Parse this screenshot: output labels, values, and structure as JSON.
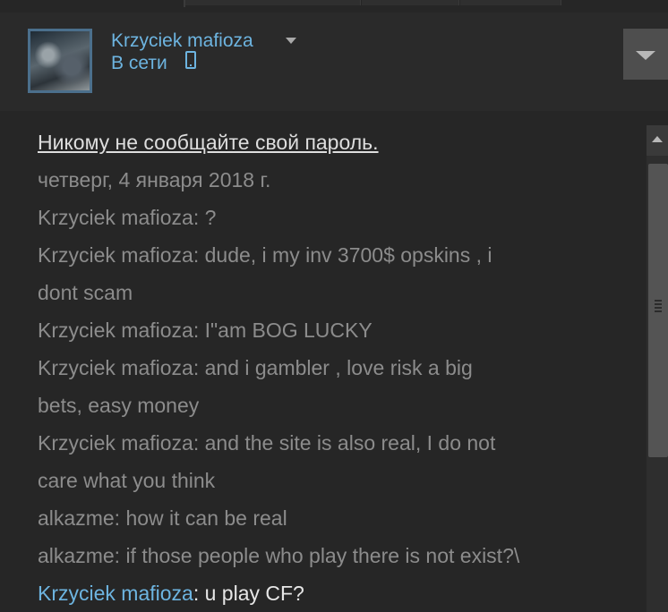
{
  "friend": {
    "name": "Krzyciek mafioza",
    "status": "В сети",
    "status_icon": "mobile-phone-icon"
  },
  "colors": {
    "background": "#262626",
    "accent": "#6db4e0",
    "muted_text": "#8c8c8c",
    "scrollbar": "#545454"
  },
  "chat": {
    "warning": "Никому не сообщайте свой пароль.",
    "date": "четверг, 4 января 2018 г.",
    "messages": [
      {
        "sender": "Krzyciek mafioza",
        "text": "?"
      },
      {
        "sender": "Krzyciek mafioza",
        "text": "dude, i my inv 3700$ opskins , i",
        "cont": "dont scam"
      },
      {
        "sender": "Krzyciek mafioza",
        "text": "I\"am BOG LUCKY"
      },
      {
        "sender": "Krzyciek mafioza",
        "text": "and i gambler , love risk a big",
        "cont": "bets, easy money"
      },
      {
        "sender": "Krzyciek mafioza",
        "text": "and the site is also real, I do not",
        "cont": "care what you think"
      },
      {
        "sender": "alkazme",
        "text": "how it can be real"
      },
      {
        "sender": "alkazme",
        "text": "if those people who play there is not exist?\\"
      },
      {
        "sender": "Krzyciek mafioza",
        "text": "u play CF?"
      }
    ]
  }
}
